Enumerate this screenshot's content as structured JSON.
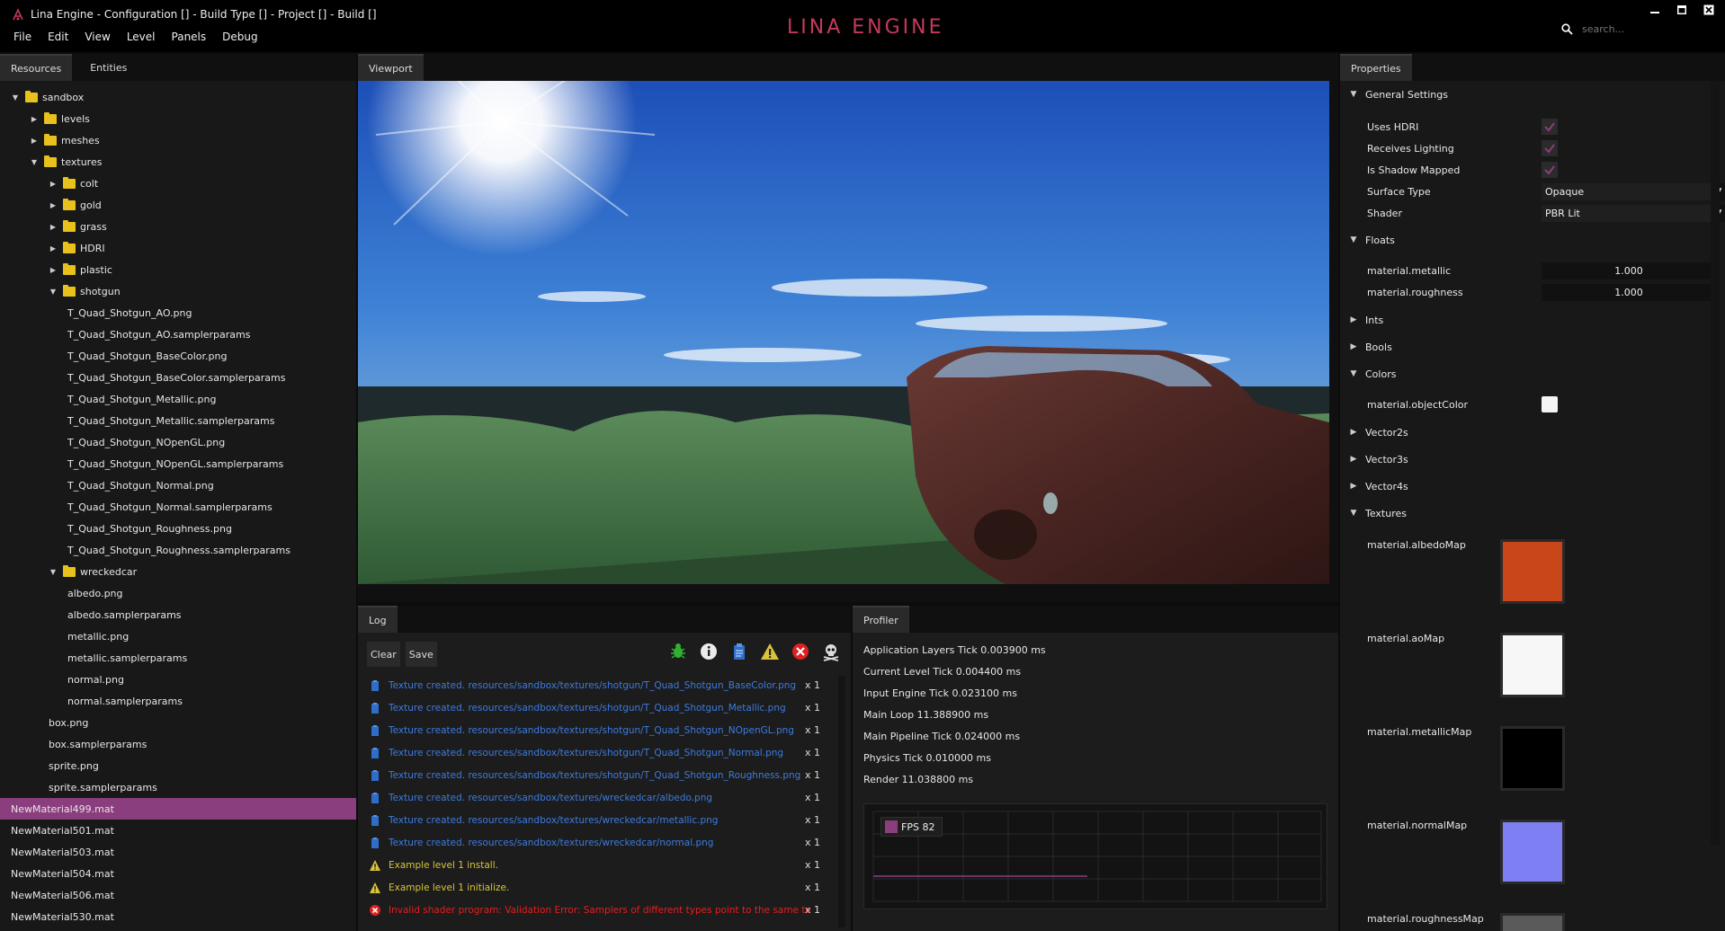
{
  "window": {
    "title": "Lina Engine - Configuration [] - Build Type [] - Project [] - Build []",
    "brand": "LINA ENGINE",
    "search_placeholder": "search..."
  },
  "menu": [
    "File",
    "Edit",
    "View",
    "Level",
    "Panels",
    "Debug"
  ],
  "left_panel": {
    "tabs": [
      "Resources",
      "Entities"
    ],
    "tree": [
      {
        "label": "sandbox",
        "type": "folder",
        "depth": 0,
        "expanded": true
      },
      {
        "label": "levels",
        "type": "folder",
        "depth": 1,
        "expanded": false
      },
      {
        "label": "meshes",
        "type": "folder",
        "depth": 1,
        "expanded": false
      },
      {
        "label": "textures",
        "type": "folder",
        "depth": 1,
        "expanded": true
      },
      {
        "label": "colt",
        "type": "folder",
        "depth": 2,
        "expanded": false
      },
      {
        "label": "gold",
        "type": "folder",
        "depth": 2,
        "expanded": false
      },
      {
        "label": "grass",
        "type": "folder",
        "depth": 2,
        "expanded": false
      },
      {
        "label": "HDRI",
        "type": "folder",
        "depth": 2,
        "expanded": false
      },
      {
        "label": "plastic",
        "type": "folder",
        "depth": 2,
        "expanded": false
      },
      {
        "label": "shotgun",
        "type": "folder",
        "depth": 2,
        "expanded": true
      },
      {
        "label": "T_Quad_Shotgun_AO.png",
        "type": "file",
        "depth": 3
      },
      {
        "label": "T_Quad_Shotgun_AO.samplerparams",
        "type": "file",
        "depth": 3
      },
      {
        "label": "T_Quad_Shotgun_BaseColor.png",
        "type": "file",
        "depth": 3
      },
      {
        "label": "T_Quad_Shotgun_BaseColor.samplerparams",
        "type": "file",
        "depth": 3
      },
      {
        "label": "T_Quad_Shotgun_Metallic.png",
        "type": "file",
        "depth": 3
      },
      {
        "label": "T_Quad_Shotgun_Metallic.samplerparams",
        "type": "file",
        "depth": 3
      },
      {
        "label": "T_Quad_Shotgun_NOpenGL.png",
        "type": "file",
        "depth": 3
      },
      {
        "label": "T_Quad_Shotgun_NOpenGL.samplerparams",
        "type": "file",
        "depth": 3
      },
      {
        "label": "T_Quad_Shotgun_Normal.png",
        "type": "file",
        "depth": 3
      },
      {
        "label": "T_Quad_Shotgun_Normal.samplerparams",
        "type": "file",
        "depth": 3
      },
      {
        "label": "T_Quad_Shotgun_Roughness.png",
        "type": "file",
        "depth": 3
      },
      {
        "label": "T_Quad_Shotgun_Roughness.samplerparams",
        "type": "file",
        "depth": 3
      },
      {
        "label": "wreckedcar",
        "type": "folder",
        "depth": 2,
        "expanded": true
      },
      {
        "label": "albedo.png",
        "type": "file",
        "depth": 3
      },
      {
        "label": "albedo.samplerparams",
        "type": "file",
        "depth": 3
      },
      {
        "label": "metallic.png",
        "type": "file",
        "depth": 3
      },
      {
        "label": "metallic.samplerparams",
        "type": "file",
        "depth": 3
      },
      {
        "label": "normal.png",
        "type": "file",
        "depth": 3
      },
      {
        "label": "normal.samplerparams",
        "type": "file",
        "depth": 3
      },
      {
        "label": "box.png",
        "type": "file",
        "depth": 2
      },
      {
        "label": "box.samplerparams",
        "type": "file",
        "depth": 2
      },
      {
        "label": "sprite.png",
        "type": "file",
        "depth": 2
      },
      {
        "label": "sprite.samplerparams",
        "type": "file",
        "depth": 2
      },
      {
        "label": "NewMaterial499.mat",
        "type": "file",
        "depth": 0,
        "selected": true
      },
      {
        "label": "NewMaterial501.mat",
        "type": "file",
        "depth": 0
      },
      {
        "label": "NewMaterial503.mat",
        "type": "file",
        "depth": 0
      },
      {
        "label": "NewMaterial504.mat",
        "type": "file",
        "depth": 0
      },
      {
        "label": "NewMaterial506.mat",
        "type": "file",
        "depth": 0
      },
      {
        "label": "NewMaterial530.mat",
        "type": "file",
        "depth": 0
      }
    ]
  },
  "viewport": {
    "tab": "Viewport"
  },
  "log": {
    "tab": "Log",
    "clear_label": "Clear",
    "save_label": "Save",
    "entries": [
      {
        "level": "info",
        "text": "Texture created. resources/sandbox/textures/shotgun/T_Quad_Shotgun_BaseColor.png",
        "count": "x 1"
      },
      {
        "level": "info",
        "text": "Texture created. resources/sandbox/textures/shotgun/T_Quad_Shotgun_Metallic.png",
        "count": "x 1"
      },
      {
        "level": "info",
        "text": "Texture created. resources/sandbox/textures/shotgun/T_Quad_Shotgun_NOpenGL.png",
        "count": "x 1"
      },
      {
        "level": "info",
        "text": "Texture created. resources/sandbox/textures/shotgun/T_Quad_Shotgun_Normal.png",
        "count": "x 1"
      },
      {
        "level": "info",
        "text": "Texture created. resources/sandbox/textures/shotgun/T_Quad_Shotgun_Roughness.png",
        "count": "x 1"
      },
      {
        "level": "info",
        "text": "Texture created. resources/sandbox/textures/wreckedcar/albedo.png",
        "count": "x 1"
      },
      {
        "level": "info",
        "text": "Texture created. resources/sandbox/textures/wreckedcar/metallic.png",
        "count": "x 1"
      },
      {
        "level": "info",
        "text": "Texture created. resources/sandbox/textures/wreckedcar/normal.png",
        "count": "x 1"
      },
      {
        "level": "warn",
        "text": "Example level 1 install.",
        "count": "x 1"
      },
      {
        "level": "warn",
        "text": "Example level 1 initialize.",
        "count": "x 1"
      },
      {
        "level": "error",
        "text": "Invalid shader program: Validation Error: Samplers of different types point to the same texture unit",
        "count": "x 1"
      }
    ]
  },
  "profiler": {
    "tab": "Profiler",
    "lines": [
      "Application Layers Tick 0.003900 ms",
      "Current Level Tick 0.004400 ms",
      "Input Engine Tick 0.023100 ms",
      "Main Loop 11.388900 ms",
      "Main Pipeline Tick 0.024000 ms",
      "Physics Tick 0.010000 ms",
      "Render 11.038800 ms"
    ],
    "fps_legend": "FPS 82"
  },
  "properties": {
    "tab": "Properties",
    "general_settings": "General Settings",
    "uses_hdri": "Uses HDRI",
    "receives_lighting": "Receives Lighting",
    "is_shadow_mapped": "Is Shadow Mapped",
    "surface_type_label": "Surface Type",
    "surface_type_value": "Opaque",
    "shader_label": "Shader",
    "shader_value": "PBR Lit",
    "floats": "Floats",
    "metallic_label": "material.metallic",
    "metallic_value": "1.000",
    "roughness_label": "material.roughness",
    "roughness_value": "1.000",
    "ints": "Ints",
    "bools": "Bools",
    "colors": "Colors",
    "object_color_label": "material.objectColor",
    "vector2s": "Vector2s",
    "vector3s": "Vector3s",
    "vector4s": "Vector4s",
    "textures": "Textures",
    "albedo_map": "material.albedoMap",
    "ao_map": "material.aoMap",
    "metallic_map": "material.metallicMap",
    "normal_map": "material.normalMap",
    "roughness_map": "material.roughnessMap"
  },
  "colors": {
    "accent": "#8b3e7d",
    "brand": "#c43a5a",
    "info": "#3c7be0",
    "warning": "#d7c43a",
    "error": "#e02020"
  }
}
